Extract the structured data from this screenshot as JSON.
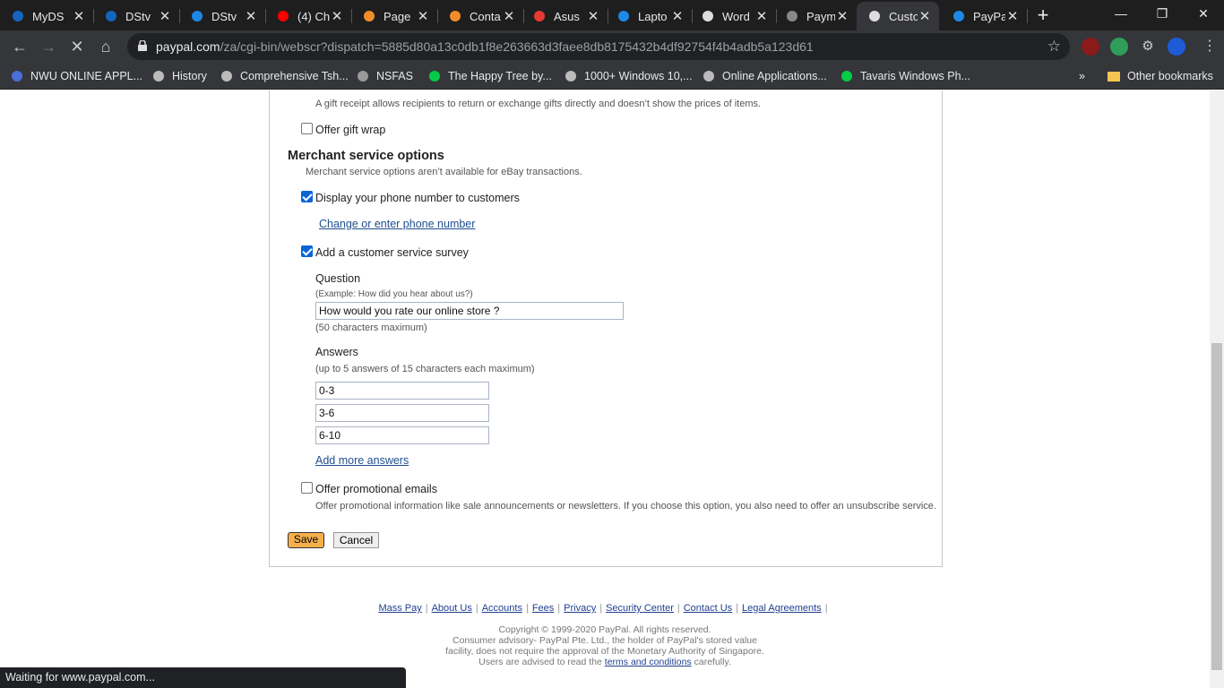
{
  "tabs": [
    {
      "label": "MyDS",
      "icon": "dstv-icon",
      "color": "#1565c0"
    },
    {
      "label": "DStv",
      "icon": "dstv-icon",
      "color": "#1565c0"
    },
    {
      "label": "DStv",
      "icon": "dstv-play-icon",
      "color": "#1e88e5"
    },
    {
      "label": "(4) Ch",
      "icon": "youtube-icon",
      "color": "#ff0000"
    },
    {
      "label": "Page",
      "icon": "t-logo-icon",
      "color": "#f28c28"
    },
    {
      "label": "Conta",
      "icon": "t-logo-icon",
      "color": "#f28c28"
    },
    {
      "label": "Asus",
      "icon": "m-logo-icon",
      "color": "#e53935"
    },
    {
      "label": "Lapto",
      "icon": "flag-icon",
      "color": "#1e88e5"
    },
    {
      "label": "Word",
      "icon": "wordpress-icon",
      "color": "#dddddd"
    },
    {
      "label": "Paym",
      "icon": "globe-icon",
      "color": "#888888"
    },
    {
      "label": "Custo",
      "icon": "loading-icon",
      "color": "#dddddd"
    },
    {
      "label": "PayPa",
      "icon": "paypal-icon",
      "color": "#1e88e5"
    }
  ],
  "address": {
    "host": "paypal.com",
    "path": "/za/cgi-bin/webscr?dispatch=5885d80a13c0db1f8e263663d3faee8db8175432b4df92754f4b4adb5a123d61"
  },
  "bookmarks": [
    {
      "label": "NWU ONLINE APPL...",
      "icon": "nwu-icon"
    },
    {
      "label": "History",
      "icon": "history-icon"
    },
    {
      "label": "Comprehensive Tsh...",
      "icon": "globe-icon"
    },
    {
      "label": "NSFAS",
      "icon": "nsfas-icon"
    },
    {
      "label": "The Happy Tree by...",
      "icon": "deviantart-icon"
    },
    {
      "label": "1000+ Windows 10,...",
      "icon": "globe-icon"
    },
    {
      "label": "Online Applications...",
      "icon": "globe-icon"
    },
    {
      "label": "Tavaris Windows Ph...",
      "icon": "deviantart-icon"
    },
    {
      "label": "»",
      "icon": ""
    },
    {
      "label": "Other bookmarks",
      "icon": "folder-icon"
    }
  ],
  "page": {
    "gift_receipt_desc": "A gift receipt allows recipients to return or exchange gifts directly and doesn’t show the prices of items.",
    "gift_wrap_label": "Offer gift wrap",
    "gift_wrap_checked": false,
    "merchant_heading": "Merchant service options",
    "merchant_note": "Merchant service options aren’t available for eBay transactions.",
    "display_phone_label": "Display your phone number to customers",
    "display_phone_checked": true,
    "change_phone_link": "Change or enter phone number",
    "survey_label": "Add a customer service survey",
    "survey_checked": true,
    "question_label": "Question",
    "question_example": "(Example: How did you hear about us?)",
    "question_value": "How would you rate our online store ?",
    "question_limit": "(50 characters maximum)",
    "answers_label": "Answers",
    "answers_limit": "(up to 5 answers of 15 characters each maximum)",
    "answers": [
      "0-3",
      "3-6",
      "6-10"
    ],
    "add_answers_link": "Add more answers",
    "promo_label": "Offer promotional emails",
    "promo_checked": false,
    "promo_desc": "Offer promotional information like sale announcements or newsletters. If you choose this option, you also need to offer an unsubscribe service.",
    "save_label": "Save",
    "cancel_label": "Cancel"
  },
  "footer": {
    "links": [
      "Mass Pay",
      "About Us",
      "Accounts",
      "Fees",
      "Privacy",
      "Security Center",
      "Contact Us",
      "Legal Agreements"
    ],
    "copyright": "Copyright © 1999-2020 PayPal. All rights reserved.",
    "advisory_1": "Consumer advisory- PayPal Pte. Ltd., the holder of PayPal's stored value",
    "advisory_2": "facility, does not require the approval of the Monetary Authority of Singapore.",
    "advisory_3_pre": "Users are advised to read the",
    "advisory_3_link": "terms and conditions",
    "advisory_3_post": "carefully."
  },
  "status_text": "Waiting for www.paypal.com..."
}
